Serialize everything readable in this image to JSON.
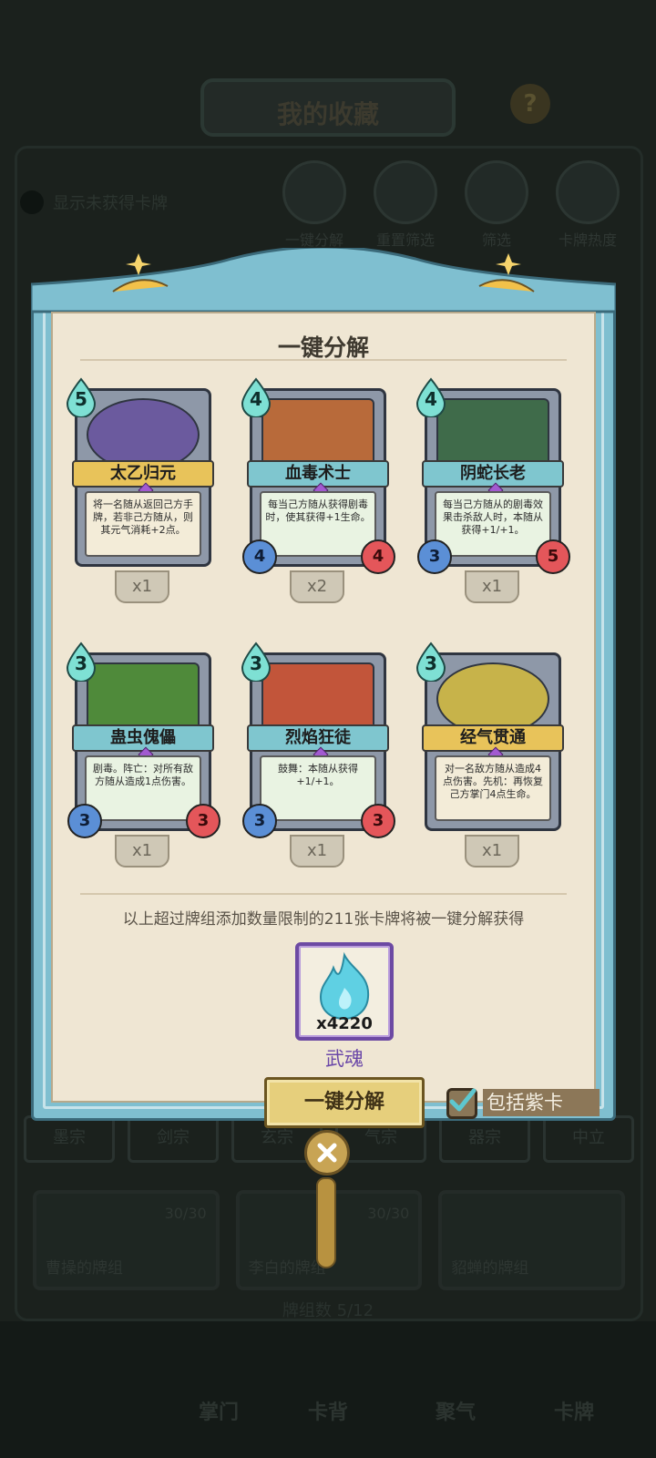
{
  "background": {
    "title": "我的收藏",
    "help_icon": "?",
    "filter_label": "显示未获得卡牌",
    "tools": [
      {
        "label": "一键分解",
        "icon": "decompose-icon"
      },
      {
        "label": "重置筛选",
        "icon": "reset-icon"
      },
      {
        "label": "筛选",
        "icon": "filter-icon"
      },
      {
        "label": "卡牌热度",
        "icon": "fire-icon"
      }
    ],
    "tabs": [
      "墨宗",
      "剑宗",
      "玄宗",
      "气宗",
      "器宗",
      "中立"
    ],
    "decks": [
      {
        "name": "曹操的牌组",
        "count": "30/30"
      },
      {
        "name": "李白的牌组",
        "count": "30/30"
      },
      {
        "name": "貂蝉的牌组",
        "count": ""
      }
    ],
    "deck_count": "牌组数 5/12",
    "nav": [
      "掌门",
      "卡背",
      "聚气",
      "卡牌"
    ]
  },
  "dialog": {
    "title": "一键分解",
    "cards": [
      {
        "name": "太乙归元",
        "cost": "5",
        "desc": "将一名随从返回己方手牌，若非己方随从，则其元气消耗+2点。",
        "count": "x1",
        "banner": "gold",
        "attack": "",
        "health": "",
        "art_color": "#6b5a9e"
      },
      {
        "name": "血毒术士",
        "cost": "4",
        "desc": "每当己方随从获得剧毒时，使其获得+1生命。",
        "count": "x2",
        "banner": "teal",
        "attack": "4",
        "health": "4",
        "art_color": "#b86a3a"
      },
      {
        "name": "阴蛇长老",
        "cost": "4",
        "desc": "每当己方随从的剧毒效果击杀敌人时，本随从获得+1/+1。",
        "count": "x1",
        "banner": "teal",
        "attack": "3",
        "health": "5",
        "art_color": "#3f6b4a"
      },
      {
        "name": "蛊虫傀儡",
        "cost": "3",
        "desc": "剧毒。阵亡：对所有敌方随从造成1点伤害。",
        "count": "x1",
        "banner": "teal",
        "attack": "3",
        "health": "3",
        "art_color": "#4f8a3a"
      },
      {
        "name": "烈焰狂徒",
        "cost": "3",
        "desc": "鼓舞：本随从获得+1/+1。",
        "count": "x1",
        "banner": "teal",
        "attack": "3",
        "health": "3",
        "art_color": "#c2553a"
      },
      {
        "name": "经气贯通",
        "cost": "3",
        "desc": "对一名敌方随从造成4点伤害。先机：再恢复己方掌门4点生命。",
        "count": "x1",
        "banner": "gold",
        "attack": "",
        "health": "",
        "art_color": "#c7b34a"
      }
    ],
    "notice": "以上超过牌组添加数量限制的211张卡牌将被一键分解获得",
    "reward": {
      "amount": "x4220",
      "name": "武魂",
      "icon": "soul-flame-icon"
    },
    "action_label": "一键分解",
    "include_purple_label": "包括紫卡",
    "include_purple_checked": true
  },
  "colors": {
    "frame": "#7fbfd0",
    "parchment": "#efe6d3",
    "purple": "#6b48a8",
    "gold_button": "#e6cf7c"
  }
}
